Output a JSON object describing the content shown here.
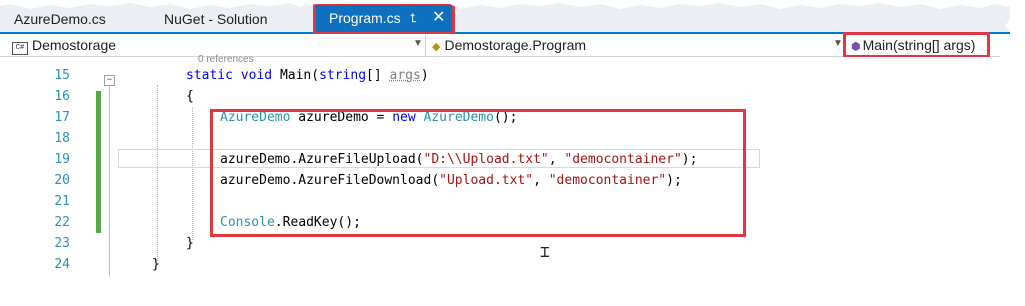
{
  "tabs": [
    {
      "label": "AzureDemo.cs",
      "active": false
    },
    {
      "label": "NuGet - Solution",
      "active": false
    },
    {
      "label": "Program.cs",
      "active": true
    }
  ],
  "nav": {
    "project": "Demostorage",
    "class": "Demostorage.Program",
    "member": "Main(string[] args)"
  },
  "editor": {
    "codelens": "0 references",
    "line_numbers": [
      "15",
      "16",
      "17",
      "18",
      "19",
      "20",
      "21",
      "22",
      "23",
      "24"
    ],
    "lines": [
      {
        "parts": [
          [
            "kw",
            "static "
          ],
          [
            "kw",
            "void "
          ],
          [
            "p",
            "Main("
          ],
          [
            "kw",
            "string"
          ],
          [
            "p",
            "[] "
          ],
          [
            "pm",
            "args"
          ],
          [
            "p",
            ")"
          ]
        ]
      },
      {
        "parts": [
          [
            "p",
            "{"
          ]
        ]
      },
      {
        "parts": [
          [
            "ty",
            "AzureDemo "
          ],
          [
            "p",
            "azureDemo = "
          ],
          [
            "kw",
            "new "
          ],
          [
            "ty",
            "AzureDemo"
          ],
          [
            "p",
            "();"
          ]
        ]
      },
      {
        "parts": []
      },
      {
        "parts": [
          [
            "p",
            "azureDemo.AzureFileUpload("
          ],
          [
            "str",
            "\"D:\\\\Upload.txt\""
          ],
          [
            "p",
            ", "
          ],
          [
            "str",
            "\"democontainer\""
          ],
          [
            "p",
            ");"
          ]
        ]
      },
      {
        "parts": [
          [
            "p",
            "azureDemo.AzureFileDownload("
          ],
          [
            "str",
            "\"Upload.txt\""
          ],
          [
            "p",
            ", "
          ],
          [
            "str",
            "\"democontainer\""
          ],
          [
            "p",
            ");"
          ]
        ]
      },
      {
        "parts": []
      },
      {
        "parts": [
          [
            "ty",
            "Console"
          ],
          [
            "p",
            ".ReadKey();"
          ]
        ]
      },
      {
        "parts": [
          [
            "p",
            "}"
          ]
        ]
      },
      {
        "parts": [
          [
            "p",
            "}"
          ]
        ]
      }
    ]
  },
  "colors": {
    "accent": "#007acc",
    "active_tab": "#0e70c0",
    "highlight_box": "#e03840",
    "keyword": "#0000ff",
    "type": "#2b91af",
    "string": "#a31515",
    "change_bar": "#57a64a"
  },
  "icons": {
    "pin": "pin-icon",
    "close": "close-icon",
    "csharp": "csharp-file-icon",
    "method": "method-icon"
  }
}
